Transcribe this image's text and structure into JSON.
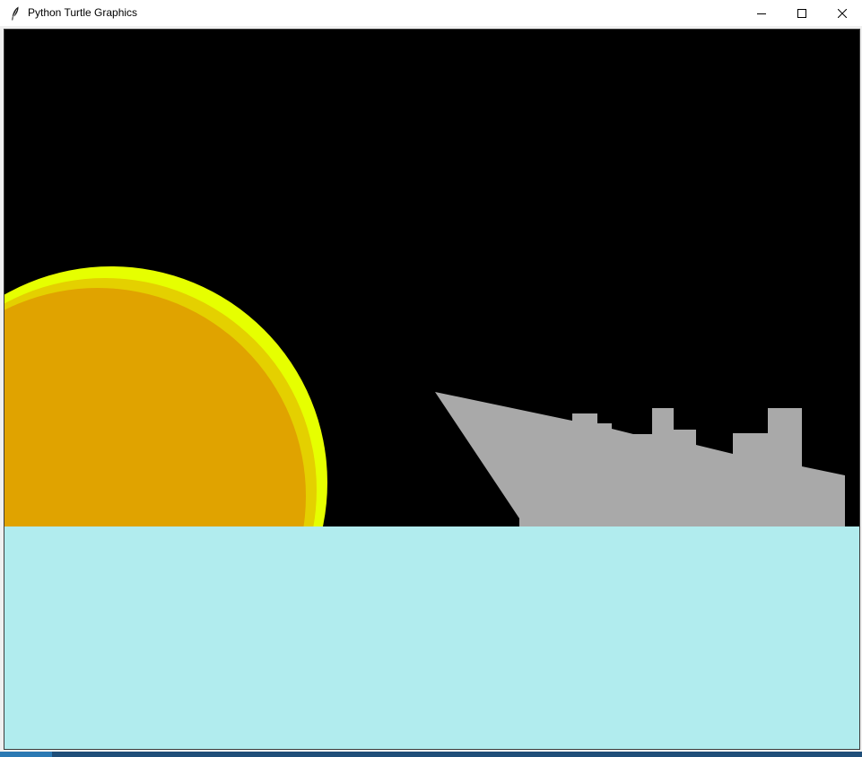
{
  "window": {
    "title": "Python Turtle Graphics",
    "controls": {
      "minimize_icon": "minimize-icon",
      "maximize_icon": "maximize-icon",
      "close_icon": "close-icon"
    },
    "app_icon": "feather-icon"
  },
  "scene": {
    "sky_color": "#000000",
    "sea_color": "#b1ecee",
    "sun_outer_color": "#e6ff00",
    "sun_inner_color": "#e0a300",
    "ship_color": "#a9a9a9"
  }
}
